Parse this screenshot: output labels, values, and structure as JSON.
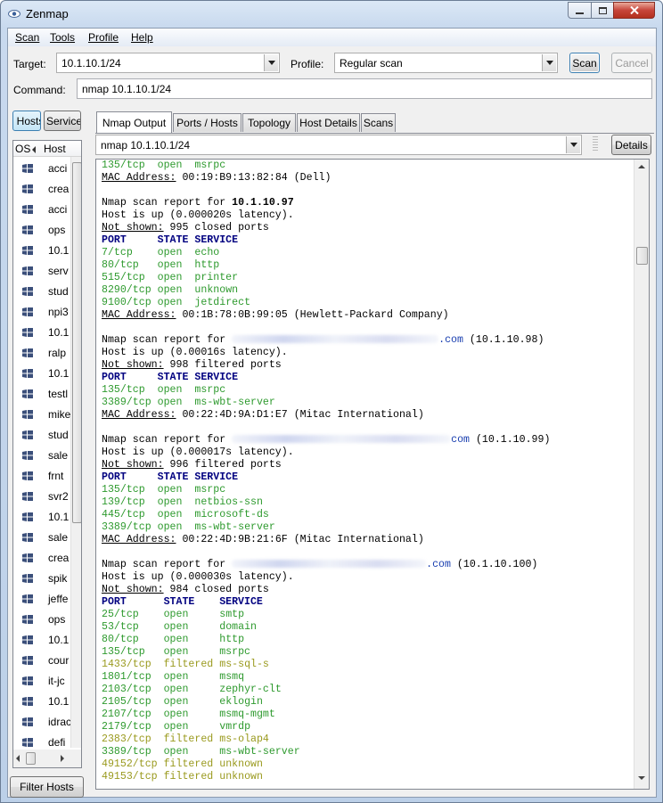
{
  "window": {
    "title": "Zenmap"
  },
  "menu": [
    "Scan",
    "Tools",
    "Profile",
    "Help"
  ],
  "toolbar": {
    "target_label": "Target:",
    "target_value": "10.1.10.1/24",
    "profile_label": "Profile:",
    "profile_value": "Regular scan",
    "scan_label": "Scan",
    "cancel_label": "Cancel"
  },
  "command": {
    "label": "Command:",
    "value": "nmap 10.1.10.1/24"
  },
  "left": {
    "hosts_btn": "Hosts",
    "services_btn": "Services",
    "os_col": "OS",
    "host_col": "Host",
    "filter_label": "Filter Hosts",
    "hosts": [
      "acci",
      "crea",
      "acci",
      "ops",
      "10.1",
      "serv",
      "stud",
      "npi3",
      "10.1",
      "ralp",
      "10.1",
      "testl",
      "mike",
      "stud",
      "sale",
      "frnt",
      "svr2",
      "10.1",
      "sale",
      "crea",
      "spik",
      "jeffe",
      "ops",
      "10.1",
      "cour",
      "it-jc",
      "10.1",
      "idrac",
      "defi"
    ]
  },
  "tabs": [
    "Nmap Output",
    "Ports / Hosts",
    "Topology",
    "Host Details",
    "Scans"
  ],
  "output_combo": "nmap 10.1.10.1/24",
  "details_label": "Details",
  "output_lines": [
    {
      "t": "p",
      "port": "135/tcp",
      "state": "open",
      "svc": "msrpc",
      "cls": "g",
      "w": "short"
    },
    {
      "t": "mac",
      "val": "00:19:B9:13:82:84 (Dell)"
    },
    {
      "t": "blank"
    },
    {
      "t": "report",
      "pre": "Nmap scan report for ",
      "host": "10.1.10.97"
    },
    {
      "t": "text",
      "v": "Host is up (0.000020s latency)."
    },
    {
      "t": "ns",
      "val": " 995 closed ports"
    },
    {
      "t": "hdr",
      "v": "PORT     STATE SERVICE"
    },
    {
      "t": "p",
      "port": "7/tcp",
      "state": "open",
      "svc": "echo",
      "cls": "g",
      "w": "short"
    },
    {
      "t": "p",
      "port": "80/tcp",
      "state": "open",
      "svc": "http",
      "cls": "g",
      "w": "short"
    },
    {
      "t": "p",
      "port": "515/tcp",
      "state": "open",
      "svc": "printer",
      "cls": "g",
      "w": "short"
    },
    {
      "t": "p",
      "port": "8290/tcp",
      "state": "open",
      "svc": "unknown",
      "cls": "g",
      "w": "short"
    },
    {
      "t": "p",
      "port": "9100/tcp",
      "state": "open",
      "svc": "jetdirect",
      "cls": "g",
      "w": "short"
    },
    {
      "t": "mac",
      "val": "00:1B:78:0B:99:05 (Hewlett-Packard Company)"
    },
    {
      "t": "blank"
    },
    {
      "t": "blurred",
      "pre": "Nmap scan report for ",
      "bw": 232,
      "suffix": ".com",
      "ip": " (10.1.10.98)"
    },
    {
      "t": "text",
      "v": "Host is up (0.00016s latency)."
    },
    {
      "t": "ns",
      "val": " 998 filtered ports"
    },
    {
      "t": "hdr",
      "v": "PORT     STATE SERVICE"
    },
    {
      "t": "p",
      "port": "135/tcp",
      "state": "open",
      "svc": "msrpc",
      "cls": "g",
      "w": "short"
    },
    {
      "t": "p",
      "port": "3389/tcp",
      "state": "open",
      "svc": "ms-wbt-server",
      "cls": "g",
      "w": "short"
    },
    {
      "t": "mac",
      "val": "00:22:4D:9A:D1:E7 (Mitac International)"
    },
    {
      "t": "blank"
    },
    {
      "t": "blurred",
      "pre": "Nmap scan report for ",
      "bw": 246,
      "suffix": "com",
      "ip": " (10.1.10.99)"
    },
    {
      "t": "text",
      "v": "Host is up (0.000017s latency)."
    },
    {
      "t": "ns",
      "val": " 996 filtered ports"
    },
    {
      "t": "hdr",
      "v": "PORT     STATE SERVICE"
    },
    {
      "t": "p",
      "port": "135/tcp",
      "state": "open",
      "svc": "msrpc",
      "cls": "g",
      "w": "short"
    },
    {
      "t": "p",
      "port": "139/tcp",
      "state": "open",
      "svc": "netbios-ssn",
      "cls": "g",
      "w": "short"
    },
    {
      "t": "p",
      "port": "445/tcp",
      "state": "open",
      "svc": "microsoft-ds",
      "cls": "g",
      "w": "short"
    },
    {
      "t": "p",
      "port": "3389/tcp",
      "state": "open",
      "svc": "ms-wbt-server",
      "cls": "g",
      "w": "short"
    },
    {
      "t": "mac",
      "val": "00:22:4D:9B:21:6F (Mitac International)"
    },
    {
      "t": "blank"
    },
    {
      "t": "blurred",
      "pre": "Nmap scan report for ",
      "bw": 218,
      "suffix": ".com",
      "ip": " (10.1.10.100)"
    },
    {
      "t": "text",
      "v": "Host is up (0.000030s latency)."
    },
    {
      "t": "ns",
      "val": " 984 closed ports"
    },
    {
      "t": "hdr",
      "v": "PORT      STATE    SERVICE"
    },
    {
      "t": "p",
      "port": "25/tcp",
      "state": "open",
      "svc": "smtp",
      "cls": "g",
      "w": "long"
    },
    {
      "t": "p",
      "port": "53/tcp",
      "state": "open",
      "svc": "domain",
      "cls": "g",
      "w": "long"
    },
    {
      "t": "p",
      "port": "80/tcp",
      "state": "open",
      "svc": "http",
      "cls": "g",
      "w": "long"
    },
    {
      "t": "p",
      "port": "135/tcp",
      "state": "open",
      "svc": "msrpc",
      "cls": "g",
      "w": "long"
    },
    {
      "t": "p",
      "port": "1433/tcp",
      "state": "filtered",
      "svc": "ms-sql-s",
      "cls": "y",
      "w": "long"
    },
    {
      "t": "p",
      "port": "1801/tcp",
      "state": "open",
      "svc": "msmq",
      "cls": "g",
      "w": "long"
    },
    {
      "t": "p",
      "port": "2103/tcp",
      "state": "open",
      "svc": "zephyr-clt",
      "cls": "g",
      "w": "long"
    },
    {
      "t": "p",
      "port": "2105/tcp",
      "state": "open",
      "svc": "eklogin",
      "cls": "g",
      "w": "long"
    },
    {
      "t": "p",
      "port": "2107/tcp",
      "state": "open",
      "svc": "msmq-mgmt",
      "cls": "g",
      "w": "long"
    },
    {
      "t": "p",
      "port": "2179/tcp",
      "state": "open",
      "svc": "vmrdp",
      "cls": "g",
      "w": "long"
    },
    {
      "t": "p",
      "port": "2383/tcp",
      "state": "filtered",
      "svc": "ms-olap4",
      "cls": "y",
      "w": "long"
    },
    {
      "t": "p",
      "port": "3389/tcp",
      "state": "open",
      "svc": "ms-wbt-server",
      "cls": "g",
      "w": "long"
    },
    {
      "t": "p",
      "port": "49152/tcp",
      "state": "filtered",
      "svc": "unknown",
      "cls": "y",
      "w": "long"
    },
    {
      "t": "p",
      "port": "49153/tcp",
      "state": "filtered",
      "svc": "unknown",
      "cls": "y",
      "w": "long"
    }
  ]
}
